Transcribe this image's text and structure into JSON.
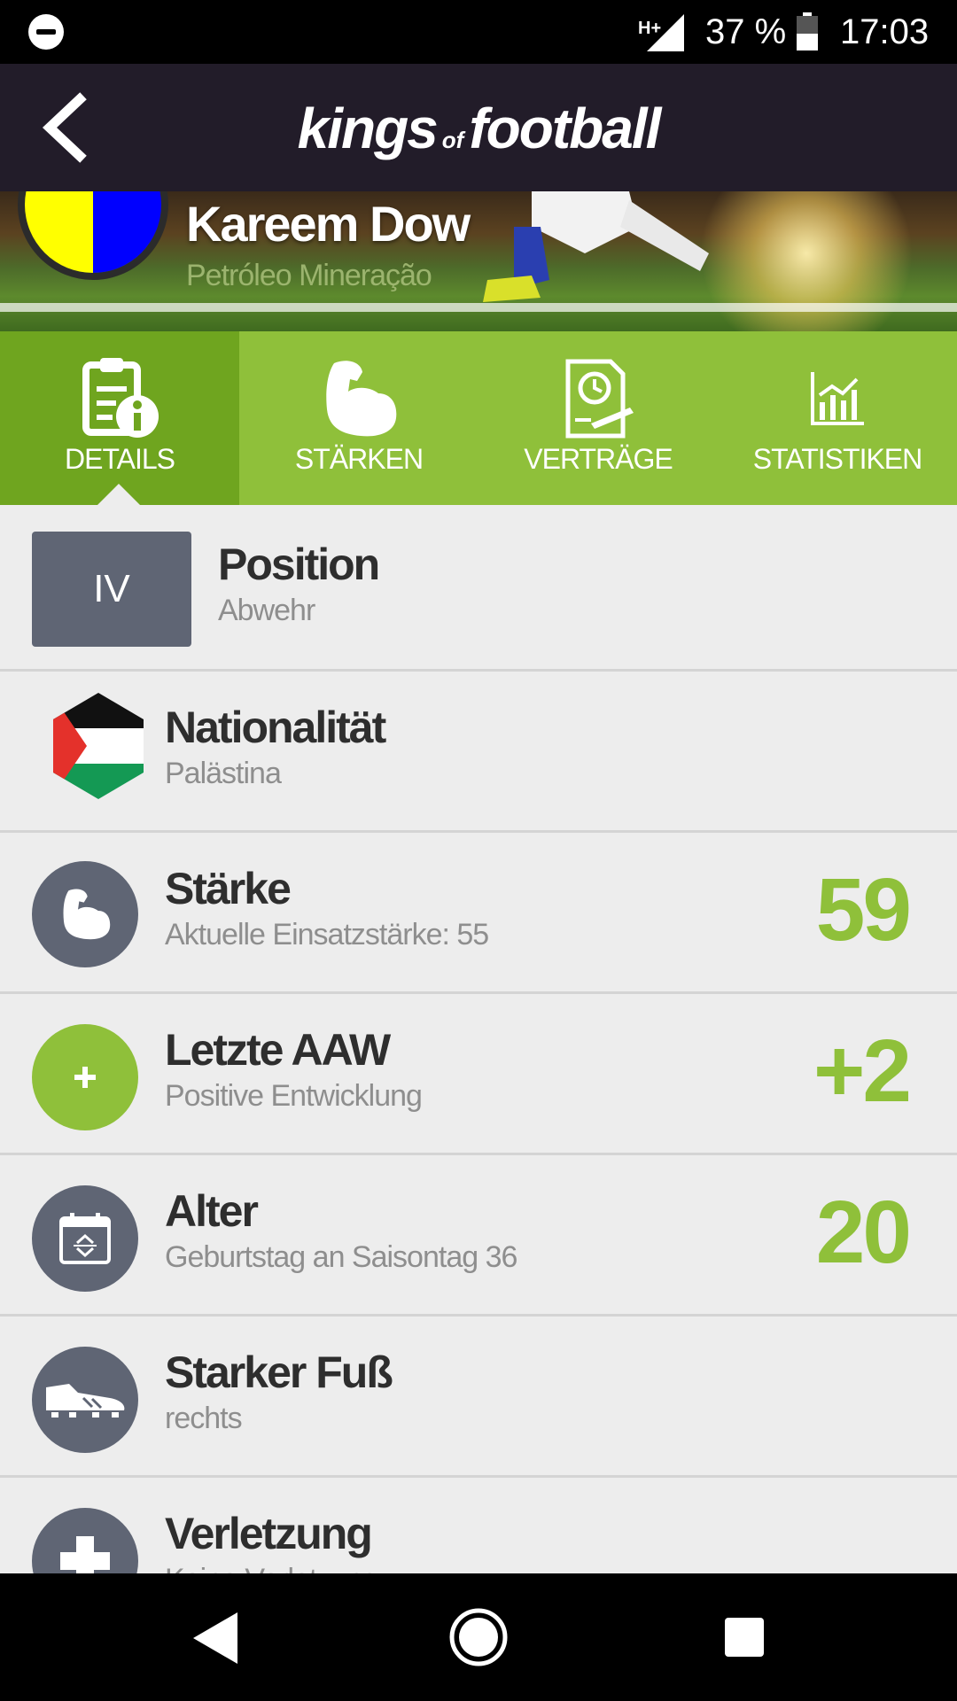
{
  "status_bar": {
    "network": "H+",
    "battery_percent": "37 %",
    "time": "17:03",
    "icons": [
      "do-not-disturb-icon",
      "signal-icon",
      "battery-icon"
    ]
  },
  "header": {
    "logo_word1": "kings",
    "logo_word2": "of",
    "logo_word3": "football",
    "back_icon": "back-arrow-icon"
  },
  "player": {
    "name": "Kareem Dow",
    "club": "Petróleo Mineração",
    "club_colors": [
      "#ffff00",
      "#0000ff"
    ]
  },
  "tabs": [
    {
      "label": "DETAILS",
      "icon": "details-info-icon",
      "active": true
    },
    {
      "label": "STÄRKEN",
      "icon": "muscle-icon",
      "active": false
    },
    {
      "label": "VERTRÄGE",
      "icon": "contract-icon",
      "active": false
    },
    {
      "label": "STATISTIKEN",
      "icon": "chart-icon",
      "active": false
    }
  ],
  "details": {
    "position": {
      "badge": "IV",
      "title": "Position",
      "sub": "Abwehr"
    },
    "nationality": {
      "title": "Nationalität",
      "sub": "Palästina",
      "icon": "palestine-flag-icon"
    },
    "strength": {
      "title": "Stärke",
      "sub": "Aktuelle Einsatzstärke: 55",
      "value": "59",
      "icon": "muscle-icon"
    },
    "last_aaw": {
      "title": "Letzte AAW",
      "sub": "Positive Entwicklung",
      "value": "+2",
      "icon": "plus-icon"
    },
    "age": {
      "title": "Alter",
      "sub": "Geburtstag an Saisontag 36",
      "value": "20",
      "icon": "calendar-icon"
    },
    "foot": {
      "title": "Starker Fuß",
      "sub": "rechts",
      "icon": "football-boot-icon"
    },
    "injury": {
      "title": "Verletzung",
      "sub": "Keine Verletzung",
      "icon": "medical-cross-icon"
    }
  },
  "colors": {
    "accent_green": "#8fc03a",
    "active_tab_green": "#6fa51f",
    "header_dark": "#221c29",
    "icon_grey": "#5f6574"
  },
  "nav_bar": {
    "icons": [
      "nav-back-icon",
      "nav-home-icon",
      "nav-recents-icon"
    ]
  }
}
